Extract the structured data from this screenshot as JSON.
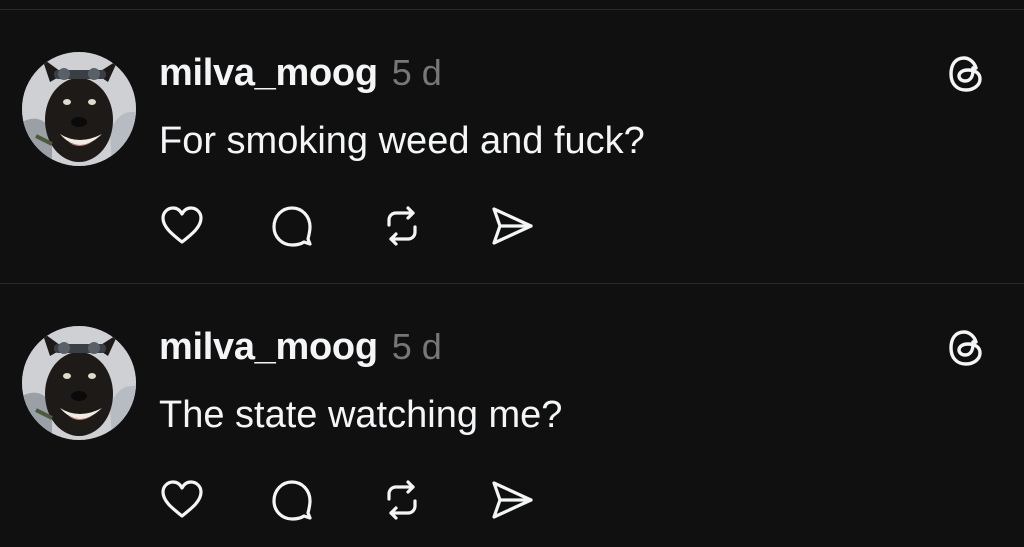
{
  "posts": [
    {
      "username": "milva_moog",
      "timestamp": "5 d",
      "text": "For smoking weed and fuck?",
      "avatar_icon": "dog-avatar",
      "menu_icon": "threads-logo-icon",
      "actions": [
        "like-heart-icon",
        "reply-bubble-icon",
        "repost-icon",
        "share-send-icon"
      ]
    },
    {
      "username": "milva_moog",
      "timestamp": "5 d",
      "text": "The state watching me?",
      "avatar_icon": "dog-avatar",
      "menu_icon": "threads-logo-icon",
      "actions": [
        "like-heart-icon",
        "reply-bubble-icon",
        "repost-icon",
        "share-send-icon"
      ]
    }
  ],
  "colors": {
    "background": "#101010",
    "text": "#f3f5f7",
    "muted": "#777777",
    "divider": "#2a2a2a"
  }
}
